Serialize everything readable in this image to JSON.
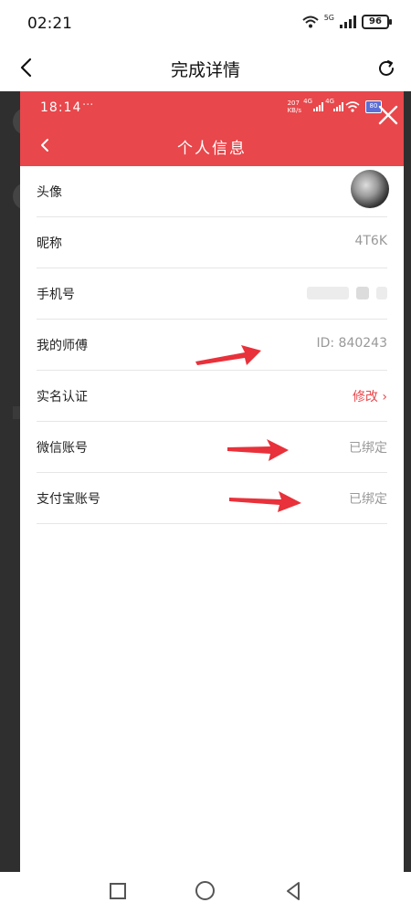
{
  "outer_status": {
    "time": "02:21",
    "network_tag": "5G",
    "battery": "96"
  },
  "outer_header": {
    "title": "完成详情"
  },
  "embedded": {
    "status": {
      "time": "18:14",
      "dots": "···",
      "speed_top": "207",
      "speed_bottom": "KB/s",
      "net1": "4G",
      "net2": "4G",
      "battery": "80"
    },
    "header": {
      "title": "个人信息"
    },
    "rows": [
      {
        "label": "头像",
        "value": ""
      },
      {
        "label": "昵称",
        "value": "4T6K"
      },
      {
        "label": "手机号",
        "value": ""
      },
      {
        "label": "我的师傅",
        "value": "ID: 840243"
      },
      {
        "label": "实名认证",
        "value": "修改 ›"
      },
      {
        "label": "微信账号",
        "value": "已绑定"
      },
      {
        "label": "支付宝账号",
        "value": "已绑定"
      }
    ]
  },
  "icons": {
    "back": "arrow-left-icon",
    "refresh": "refresh-icon",
    "close": "close-icon",
    "nav_recent": "square-icon",
    "nav_home": "circle-icon",
    "nav_back": "triangle-back-icon"
  },
  "colors": {
    "accent": "#e8474b",
    "annotation_arrow": "#e8313a"
  }
}
